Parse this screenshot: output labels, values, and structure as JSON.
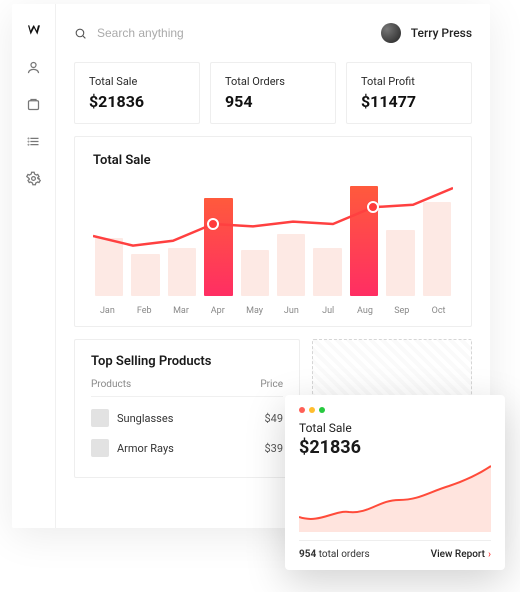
{
  "header": {
    "search_placeholder": "Search anything",
    "username": "Terry Press"
  },
  "stats": [
    {
      "label": "Total Sale",
      "value": "$21836"
    },
    {
      "label": "Total Orders",
      "value": "954"
    },
    {
      "label": "Total Profit",
      "value": "$11477"
    }
  ],
  "chart": {
    "title": "Total Sale"
  },
  "products": {
    "title": "Top Selling Products",
    "col_products": "Products",
    "col_price": "Price",
    "rows": [
      {
        "name": "Sunglasses",
        "price": "$49"
      },
      {
        "name": "Armor Rays",
        "price": "$39"
      }
    ]
  },
  "mini": {
    "title": "Total Sale",
    "value": "$21836",
    "orders_count": "954",
    "orders_label": " total orders",
    "view_label": "View Report"
  },
  "chart_data": {
    "type": "bar",
    "title": "Total Sale",
    "categories": [
      "Jan",
      "Feb",
      "Mar",
      "Apr",
      "May",
      "Jun",
      "Jul",
      "Aug",
      "Sep",
      "Oct"
    ],
    "values": [
      48,
      35,
      40,
      82,
      38,
      52,
      40,
      92,
      55,
      78
    ],
    "highlight_categories": [
      "Apr",
      "Aug"
    ],
    "overlay_line": {
      "type": "line",
      "x": [
        "Jan",
        "Feb",
        "Mar",
        "Apr",
        "May",
        "Jun",
        "Jul",
        "Aug",
        "Sep",
        "Oct"
      ],
      "y": [
        50,
        42,
        46,
        60,
        58,
        62,
        60,
        74,
        76,
        90
      ]
    },
    "ylim": [
      0,
      100
    ],
    "xlabel": "",
    "ylabel": ""
  }
}
